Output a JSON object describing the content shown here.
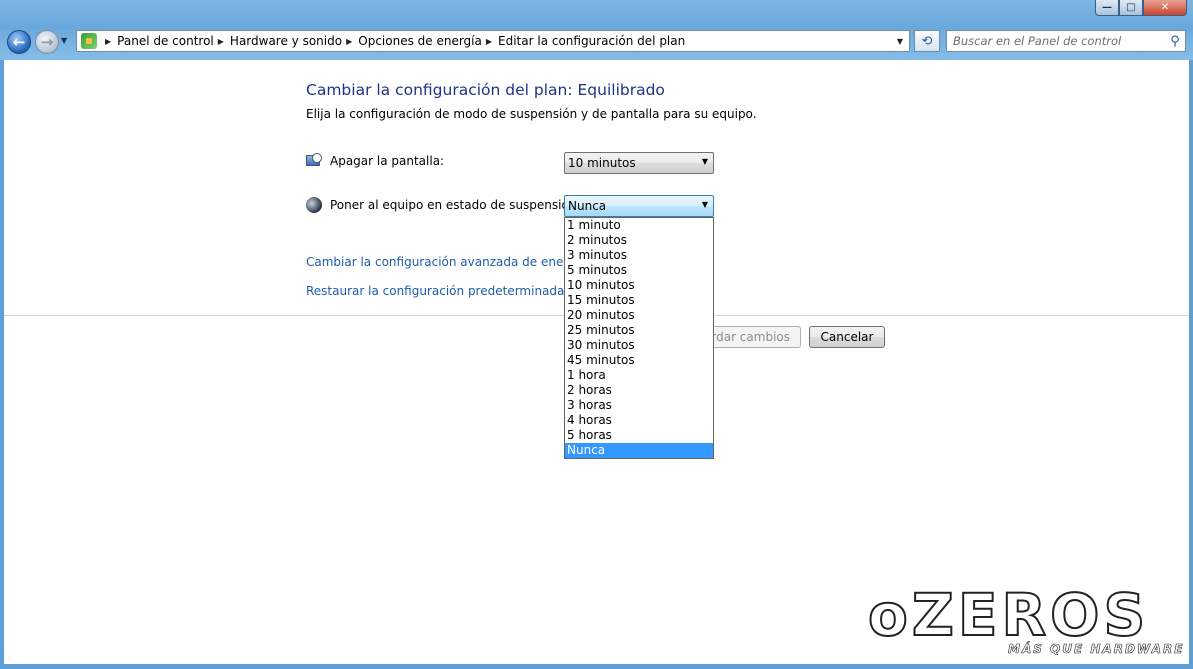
{
  "window": {
    "controls": {
      "minimize": "—",
      "maximize": "□",
      "close": "✕"
    }
  },
  "nav": {
    "back_glyph": "←",
    "forward_glyph": "→",
    "recent_glyph": "▼"
  },
  "address": {
    "crumbs": [
      "Panel de control",
      "Hardware y sonido",
      "Opciones de energía",
      "Editar la configuración del plan"
    ],
    "dropdown_glyph": "▼",
    "refresh_glyph": "⟲"
  },
  "search": {
    "placeholder": "Buscar en el Panel de control"
  },
  "page": {
    "title": "Cambiar la configuración del plan: Equilibrado",
    "description": "Elija la configuración de modo de suspensión y de pantalla para su equipo."
  },
  "settings": {
    "display_off": {
      "label": "Apagar la pantalla:",
      "value": "10 minutos"
    },
    "sleep": {
      "label": "Poner al equipo en estado de suspensión:",
      "value": "Nunca"
    }
  },
  "dropdown": {
    "options": [
      "1 minuto",
      "2 minutos",
      "3 minutos",
      "5 minutos",
      "10 minutos",
      "15 minutos",
      "20 minutos",
      "25 minutos",
      "30 minutos",
      "45 minutos",
      "1 hora",
      "2 horas",
      "3 horas",
      "4 horas",
      "5 horas",
      "Nunca"
    ],
    "selected": "Nunca"
  },
  "links": {
    "advanced": "Cambiar la configuración avanzada de energía",
    "restore": "Restaurar la configuración predeterminada de est"
  },
  "buttons": {
    "save": "ardar cambios",
    "cancel": "Cancelar"
  },
  "watermark": {
    "logo_text": "oZEROS",
    "tagline": "MÁS QUE HARDWARE"
  },
  "colors": {
    "title_blue": "#1e3287",
    "link_blue": "#1e5cab",
    "selection": "#3399ff",
    "chrome": "#6aa8dc"
  }
}
